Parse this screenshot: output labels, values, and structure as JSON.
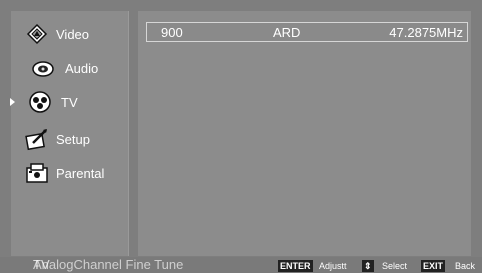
{
  "menu": {
    "items": [
      {
        "label": "Video",
        "icon": "video-icon"
      },
      {
        "label": "Audio",
        "icon": "audio-icon"
      },
      {
        "label": "TV",
        "icon": "tv-icon",
        "selected": true
      },
      {
        "label": "Setup",
        "icon": "setup-icon"
      },
      {
        "label": "Parental",
        "icon": "parental-icon"
      }
    ]
  },
  "channel": {
    "number": "900",
    "name": "ARD",
    "frequency": "47.2875MHz"
  },
  "status": {
    "title_overlay": "TV",
    "title": "AnalogChannel Fine Tune",
    "enter_key": "ENTER",
    "enter_label": "Adjustt",
    "select_key": "⇕",
    "select_label": "Select",
    "exit_key": "EXIT",
    "exit_label": "Back"
  }
}
